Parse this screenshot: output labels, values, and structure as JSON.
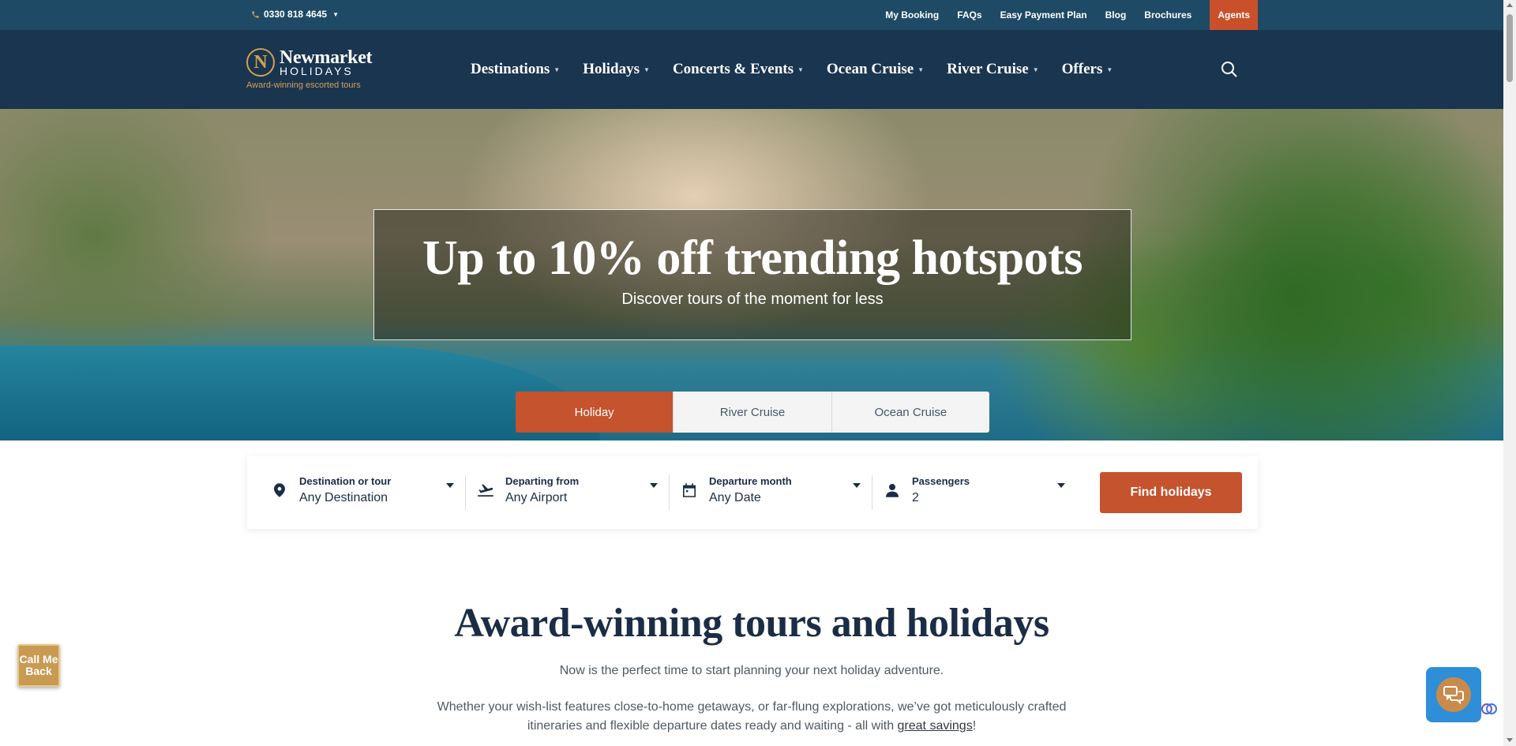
{
  "topbar": {
    "phone": "0330 818 4645",
    "links": [
      "My Booking",
      "FAQs",
      "Easy Payment Plan",
      "Blog",
      "Brochures"
    ],
    "agents": "Agents",
    "agents_color": "#c9502b"
  },
  "brand": {
    "mark": "N",
    "name": "Newmarket",
    "sub": "HOLIDAYS",
    "tagline": "Award-winning escorted tours",
    "gold": "#d0a250",
    "navy": "#1a3550"
  },
  "nav": {
    "items": [
      "Destinations",
      "Holidays",
      "Concerts & Events",
      "Ocean Cruise",
      "River Cruise",
      "Offers"
    ]
  },
  "hero": {
    "title": "Up to 10% off trending hotspots",
    "subtitle": "Discover tours of the moment for less",
    "tabs": [
      "Holiday",
      "River Cruise",
      "Ocean Cruise"
    ],
    "active_tab": "Holiday"
  },
  "search": {
    "fields": [
      {
        "label": "Destination or tour",
        "value": "Any Destination",
        "icon": "map-pin-icon"
      },
      {
        "label": "Departing from",
        "value": "Any Airport",
        "icon": "plane-departure-icon"
      },
      {
        "label": "Departure month",
        "value": "Any Date",
        "icon": "calendar-icon"
      },
      {
        "label": "Passengers",
        "value": "2",
        "icon": "person-icon"
      }
    ],
    "button": "Find holidays",
    "accent": "#c4532e"
  },
  "intro": {
    "title": "Award-winning tours and holidays",
    "p1": "Now is the perfect time to start planning your next holiday adventure.",
    "p2_start": "Whether your wish-list features close-to-home getaways, or far-flung explorations, we’ve got meticulously crafted itineraries and flexible departure dates ready and waiting - all with ",
    "p2_link": "great savings",
    "p2_end": "!"
  },
  "widgets": {
    "call_me_back": "Call Me Back",
    "chat_icon": "chat-bubbles-icon"
  }
}
